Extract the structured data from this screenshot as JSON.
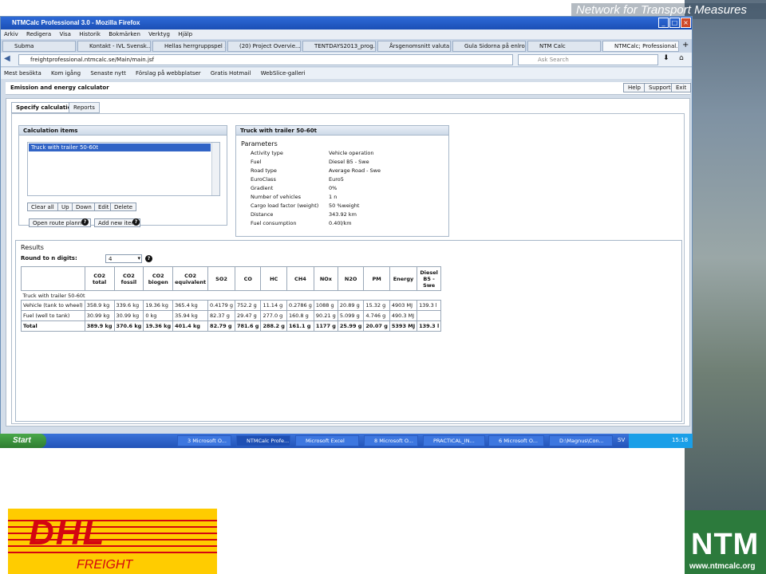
{
  "slide": {
    "banner": "Network for Transport Measures",
    "ntm_logo": "NTM",
    "ntm_url": "www.ntmcalc.org",
    "dhl_logo": "DHL",
    "dhl_sub": "FREIGHT"
  },
  "browser": {
    "title": "NTMCalc Professional 3.0 - Mozilla Firefox",
    "menu": [
      "Arkiv",
      "Redigera",
      "Visa",
      "Historik",
      "Bokmärken",
      "Verktyg",
      "Hjälp"
    ],
    "tabs": [
      "Subma",
      "Kontakt - IVL Svensk...",
      "Hellas herrgruppspel ...",
      "(20) Project Overvie...",
      "TENTDAYS2013_prog...",
      "Årsgenomsnitt valuta...",
      "Gula Sidorna på enlro...",
      "NTM Calc",
      "NTMCalc; Professional..."
    ],
    "url": "freightprofessional.ntmcalc.se/Main/main.jsf",
    "search_placeholder": "Ask Search",
    "bookmarks": [
      "Mest besökta",
      "Kom igång",
      "Senaste nytt",
      "Förslag på webbplatser",
      "Gratis Hotmail",
      "WebSlice-galleri"
    ]
  },
  "app": {
    "title": "Emission and energy calculator",
    "top_buttons": [
      "Help",
      "Support",
      "Exit"
    ],
    "tabs": [
      "Specify calculation",
      "Reports"
    ],
    "calc_items": {
      "title": "Calculation items",
      "items": [
        "Truck with trailer 50-60t"
      ],
      "buttons": [
        "Clear all",
        "Up",
        "Down",
        "Edit",
        "Delete"
      ],
      "open_route": "Open route planner",
      "add_new": "Add new item"
    },
    "params": {
      "title": "Truck with trailer 50-60t",
      "heading": "Parameters",
      "rows": [
        [
          "Activity type",
          "Vehicle operation"
        ],
        [
          "Fuel",
          "Diesel B5 - Swe"
        ],
        [
          "Road type",
          "Average Road - Swe"
        ],
        [
          "EuroClass",
          "Euro5"
        ],
        [
          "Gradient",
          "0%"
        ],
        [
          "Number of vehicles",
          "1 n"
        ],
        [
          "Cargo load factor (weight)",
          "50 %weight"
        ],
        [
          "Distance",
          "343.92 km"
        ],
        [
          "Fuel consumption",
          "0.40l/km"
        ]
      ]
    },
    "results": {
      "title": "Results",
      "round_label": "Round to n digits:",
      "round_value": "4",
      "headers": [
        "CO2 total",
        "CO2 fossil",
        "CO2 biogen",
        "CO2 equivalent",
        "SO2",
        "CO",
        "HC",
        "CH4",
        "NOx",
        "N2O",
        "PM",
        "Energy",
        "Diesel B5 - Swe"
      ],
      "group": "Truck with trailer 50-60t",
      "rows": [
        {
          "label": "Vehicle (tank to wheel)",
          "cells": [
            "358.9 kg",
            "339.6 kg",
            "19.36 kg",
            "365.4 kg",
            "0.4179 g",
            "752.2 g",
            "11.14 g",
            "0.2786 g",
            "1088 g",
            "20.89 g",
            "15.32 g",
            "4903 MJ",
            "139.3 l"
          ]
        },
        {
          "label": "Fuel (well to tank)",
          "cells": [
            "30.99 kg",
            "30.99 kg",
            "0 kg",
            "35.94 kg",
            "82.37 g",
            "29.47 g",
            "277.0 g",
            "160.8 g",
            "90.21 g",
            "5.099 g",
            "4.746 g",
            "490.3 MJ",
            ""
          ]
        },
        {
          "label": "Total",
          "cells": [
            "389.9 kg",
            "370.6 kg",
            "19.36 kg",
            "401.4 kg",
            "82.79 g",
            "781.6 g",
            "288.2 g",
            "161.1 g",
            "1177 g",
            "25.99 g",
            "20.07 g",
            "5393 MJ",
            "139.3 l"
          ]
        }
      ]
    }
  },
  "taskbar": {
    "start": "Start",
    "items": [
      "3 Microsoft O...",
      "NTMCalc Profe...",
      "Microsoft Excel",
      "8 Microsoft O...",
      "PRACTICAL_IN...",
      "6 Microsoft O...",
      "D:\\Magnus\\Con...",
      "SV"
    ],
    "clock": "15:18"
  }
}
